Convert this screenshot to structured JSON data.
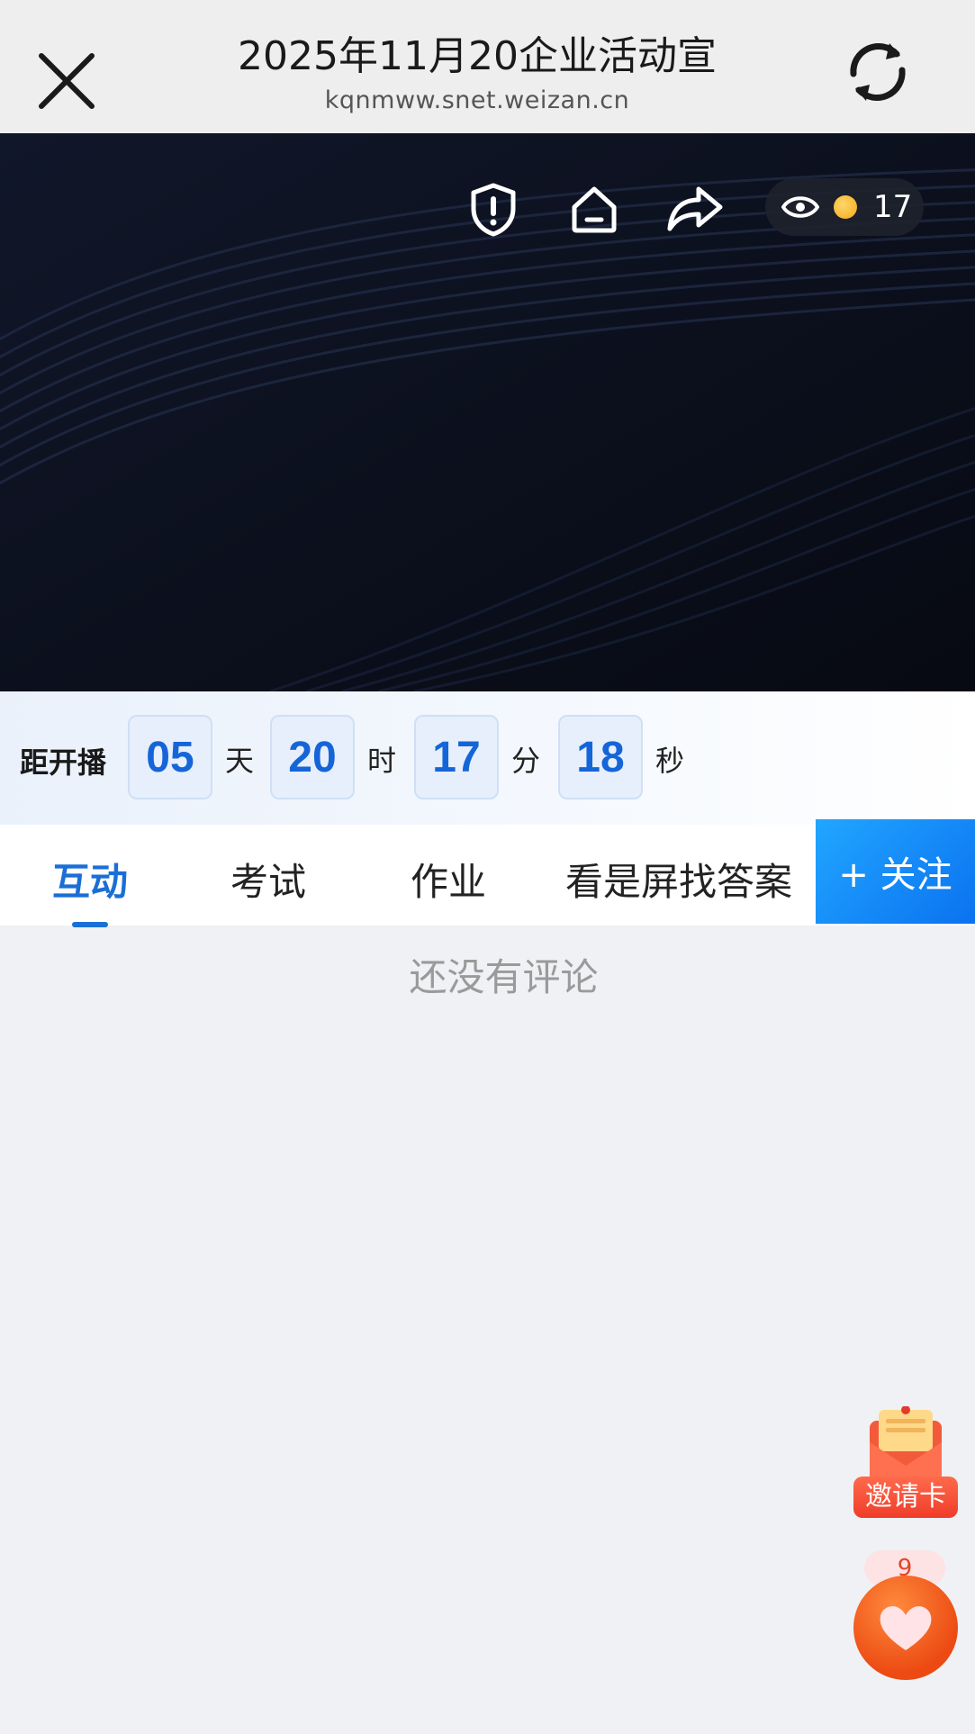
{
  "header": {
    "title": "2025年11月20企业活动宣",
    "url": "kqnmww.snet.weizan.cn"
  },
  "video": {
    "viewer_count": "17",
    "icons": [
      "shield-alert-icon",
      "home-icon",
      "share-icon",
      "eye-icon",
      "coin-icon"
    ]
  },
  "countdown": {
    "label": "距开播",
    "days": "05",
    "days_unit": "天",
    "hours": "20",
    "hours_unit": "时",
    "minutes": "17",
    "minutes_unit": "分",
    "seconds": "18",
    "seconds_unit": "秒"
  },
  "tabs": [
    {
      "label": "互动",
      "active": true
    },
    {
      "label": "考试",
      "active": false
    },
    {
      "label": "作业",
      "active": false
    },
    {
      "label": "看是屏找答案",
      "active": false
    }
  ],
  "follow_label": "+ 关注",
  "comments": {
    "empty_text": "还没有评论"
  },
  "floating": {
    "invite_label": "邀请卡",
    "like_count": "9"
  },
  "colors": {
    "accent": "#1a6fd6",
    "follow_bg": "#0b72f0",
    "like": "#ec4a12"
  }
}
